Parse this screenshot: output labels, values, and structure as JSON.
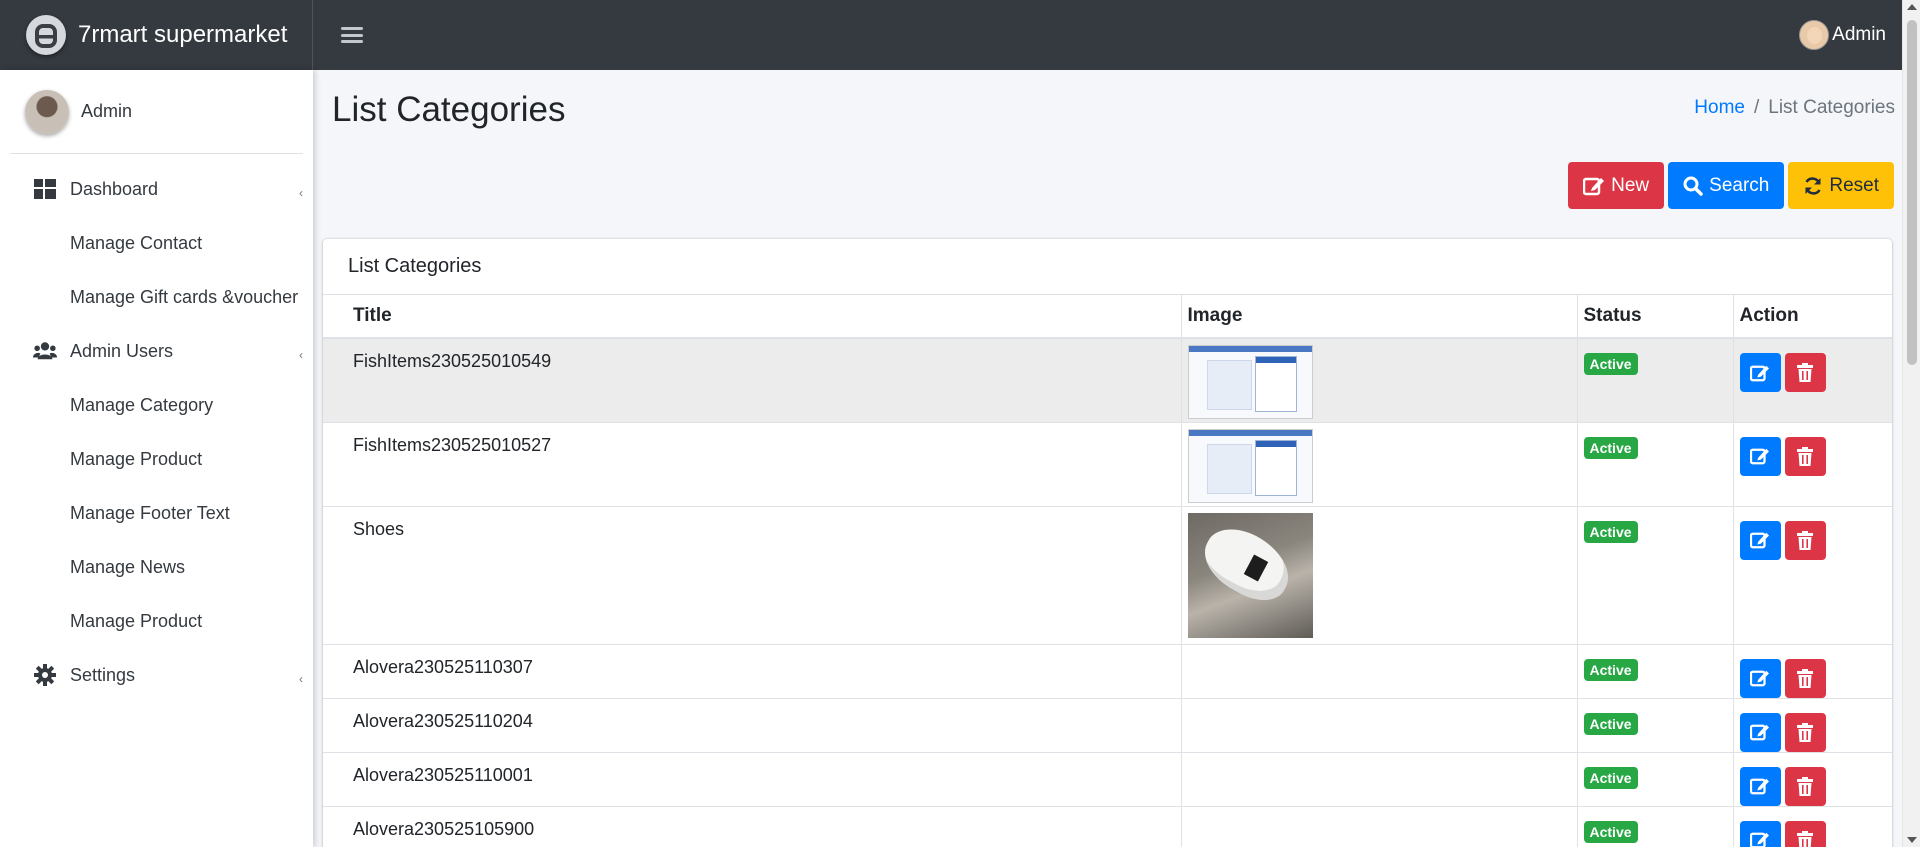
{
  "topbar": {
    "brand": "7rmart supermarket",
    "user": "Admin"
  },
  "sidebar": {
    "user": "Admin",
    "items": [
      {
        "label": "Dashboard",
        "icon": "dashboard-icon",
        "type": "parent"
      },
      {
        "label": "Manage Contact",
        "type": "child"
      },
      {
        "label": "Manage Gift cards &voucher",
        "type": "child"
      },
      {
        "label": "Admin Users",
        "icon": "users-icon",
        "type": "parent"
      },
      {
        "label": "Manage Category",
        "type": "child"
      },
      {
        "label": "Manage Product",
        "type": "child"
      },
      {
        "label": "Manage Footer Text",
        "type": "child"
      },
      {
        "label": "Manage News",
        "type": "child"
      },
      {
        "label": "Manage Product",
        "type": "child"
      },
      {
        "label": "Settings",
        "icon": "gear-icon",
        "type": "parent"
      }
    ]
  },
  "page": {
    "title": "List Categories",
    "breadcrumb": {
      "home": "Home",
      "current": "List Categories"
    },
    "buttons": {
      "new": "New",
      "search": "Search",
      "reset": "Reset"
    }
  },
  "card": {
    "title": "List Categories",
    "columns": [
      "Title",
      "Image",
      "Status",
      "Action"
    ],
    "rows": [
      {
        "title": "FishItems230525010549",
        "image": "screenshot",
        "status": "Active"
      },
      {
        "title": "FishItems230525010527",
        "image": "screenshot",
        "status": "Active"
      },
      {
        "title": "Shoes",
        "image": "shoe",
        "status": "Active"
      },
      {
        "title": "Alovera230525110307",
        "image": "",
        "status": "Active"
      },
      {
        "title": "Alovera230525110204",
        "image": "",
        "status": "Active"
      },
      {
        "title": "Alovera230525110001",
        "image": "",
        "status": "Active"
      },
      {
        "title": "Alovera230525105900",
        "image": "",
        "status": "Active"
      }
    ]
  },
  "colors": {
    "navbar": "#343a40",
    "primary": "#007bff",
    "danger": "#dc3545",
    "warning": "#ffc107",
    "success": "#28a745"
  }
}
